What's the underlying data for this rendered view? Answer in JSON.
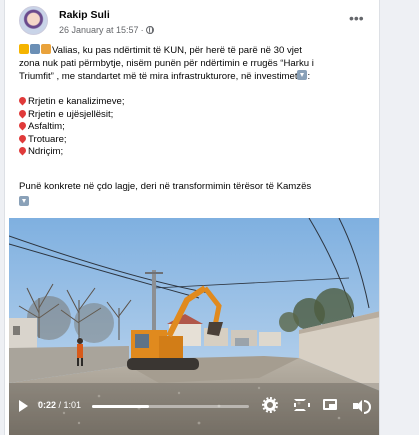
{
  "post": {
    "author": "Rakip Suli",
    "date": "26 January at 15:57",
    "privacy_icon": "globe-icon",
    "more_icon": "more-options-icon"
  },
  "body": {
    "intro_line1": "Valias, ku pas ndërtimit të KUN, për herë të parë në 30 vjet",
    "intro_line2": "zona nuk pati përmbytje, nisëm punën për ndërtimin e rrugës “Harku i",
    "intro_line3": "Triumfit” , me standartet më të mira infrastrukturore, në investimet",
    "items": [
      "Rrjetin e kanalizimeve;",
      "Rrjetin e ujësjellësit;",
      "Asfaltim;",
      "Trotuare;",
      "Ndriçim;"
    ],
    "closing": "Punë konkrete në çdo lagje, deri në transformimin tërësor të Kamzës"
  },
  "video": {
    "current_time": "0:22",
    "duration": "/ 1:01",
    "progress": 0.36
  },
  "colors": {
    "text": "#050505",
    "meta": "#65676b",
    "sky": "#8fb9e3",
    "excavator": "#e08a1e"
  }
}
